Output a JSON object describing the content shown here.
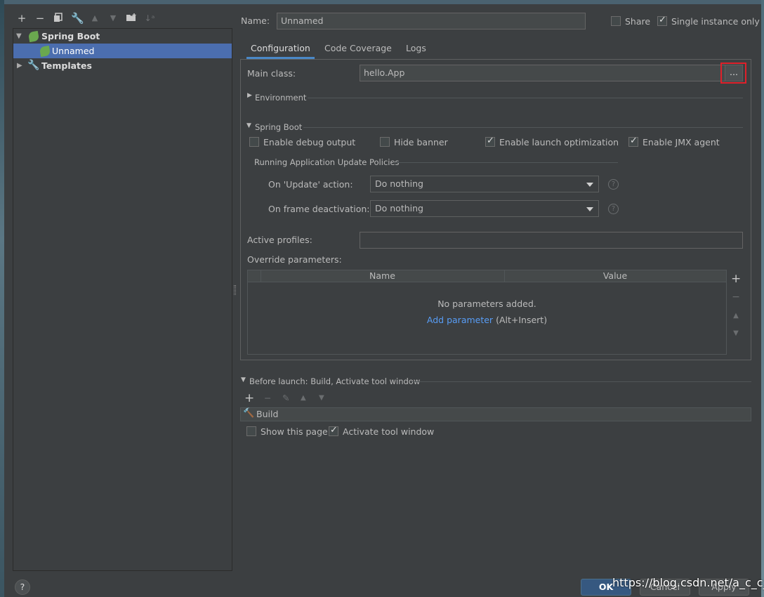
{
  "toolbar": {
    "icons": [
      "add-icon",
      "remove-icon",
      "copy-icon",
      "wrench-icon",
      "move-up-icon",
      "move-down-icon",
      "new-folder-icon",
      "sort-icon"
    ]
  },
  "tree": {
    "spring_boot": "Spring Boot",
    "unnamed": "Unnamed",
    "templates": "Templates"
  },
  "header": {
    "name_label": "Name:",
    "name_value": "Unnamed",
    "share_label": "Share",
    "share_checked": false,
    "single_instance_label": "Single instance only",
    "single_instance_checked": true
  },
  "tabs": [
    "Configuration",
    "Code Coverage",
    "Logs"
  ],
  "config": {
    "main_class_label": "Main class:",
    "main_class_value": "hello.App",
    "browse_label": "...",
    "environment_label": "Environment",
    "spring_boot_section": "Spring Boot",
    "enable_debug_output": "Enable debug output",
    "hide_banner": "Hide banner",
    "enable_launch_optimization": "Enable launch optimization",
    "enable_jmx_agent": "Enable JMX agent",
    "policies_label": "Running Application Update Policies",
    "on_update_label": "On 'Update' action:",
    "on_update_value": "Do nothing",
    "on_frame_label": "On frame deactivation:",
    "on_frame_value": "Do nothing",
    "help_glyph": "?",
    "active_profiles_label": "Active profiles:",
    "active_profiles_value": "",
    "override_label": "Override parameters:",
    "columns": [
      "Name",
      "Value"
    ],
    "empty_text": "No parameters added.",
    "add_parameter": "Add parameter",
    "add_parameter_shortcut": "(Alt+Insert)"
  },
  "before_launch": {
    "title": "Before launch: Build, Activate tool window",
    "item": "Build",
    "show_this_page": "Show this page",
    "activate_tool_window": "Activate tool window"
  },
  "buttons": {
    "help": "?",
    "ok": "OK",
    "cancel": "Cancel",
    "apply": "Apply"
  },
  "watermark": "https://blog.csdn.net/a_c_c_a"
}
